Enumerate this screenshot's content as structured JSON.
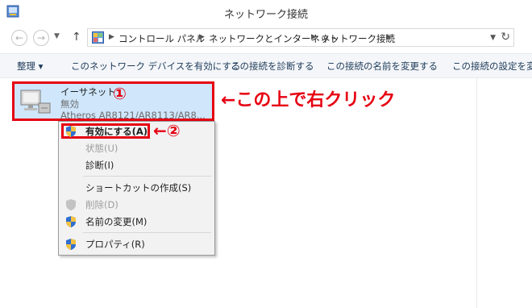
{
  "window": {
    "title": "ネットワーク接続"
  },
  "nav": {
    "back": "←",
    "forward": "→",
    "up": "↑",
    "refresh": "↻"
  },
  "address": {
    "crumbs": [
      "コントロール パネル",
      "ネットワークとインターネット",
      "ネットワーク接続"
    ]
  },
  "commands": {
    "organize": "整理 ▾",
    "enable": "このネットワーク デバイスを有効にする",
    "diagnose": "この接続を診断する",
    "rename": "この接続の名前を変更する",
    "settings": "この接続の設定を変"
  },
  "adapter": {
    "name": "イーサネット",
    "status": "無効",
    "driver": "Atheros AR8121/AR8113/AR8..."
  },
  "annotations": {
    "badge1": "①",
    "hint": "←この上で右クリック",
    "badge2": "←②"
  },
  "context_menu": {
    "items": [
      {
        "label": "有効にする(A)",
        "state": "bold",
        "icon": "uac-shield-icon"
      },
      {
        "label": "状態(U)",
        "state": "disabled"
      },
      {
        "label": "診断(I)",
        "state": "normal"
      },
      {
        "label": "ショートカットの作成(S)",
        "state": "normal"
      },
      {
        "label": "削除(D)",
        "state": "disabled",
        "icon": "uac-shield-icon"
      },
      {
        "label": "名前の変更(M)",
        "state": "normal",
        "icon": "uac-shield-icon"
      },
      {
        "label": "プロパティ(R)",
        "state": "normal",
        "icon": "uac-shield-icon"
      }
    ]
  },
  "colors": {
    "annotation": "#e60012",
    "selection": "#cfe6fb"
  }
}
